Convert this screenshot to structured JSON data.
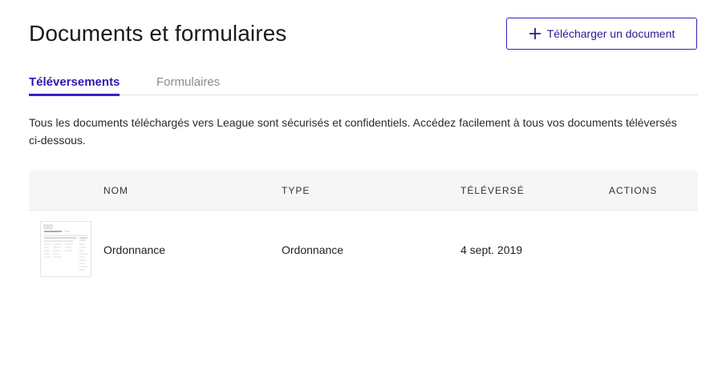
{
  "header": {
    "title": "Documents et formulaires",
    "upload_label": "Télécharger un document",
    "upload_icon": "plus-icon"
  },
  "tabs": [
    {
      "label": "Téléversements",
      "active": true
    },
    {
      "label": "Formulaires",
      "active": false
    }
  ],
  "description": "Tous les documents téléchargés vers League sont sécurisés et confidentiels. Accédez facilement à tous vos documents téléversés ci-dessous.",
  "table": {
    "columns": [
      "NOM",
      "TYPE",
      "TÉLÉVERSÉ",
      "ACTIONS"
    ],
    "rows": [
      {
        "name": "Ordonnance",
        "type": "Ordonnance",
        "uploaded": "4 sept. 2019"
      }
    ]
  },
  "colors": {
    "accent": "#3a1fc7",
    "muted_tab": "#8a8a93",
    "header_bg": "#f6f6f6"
  }
}
